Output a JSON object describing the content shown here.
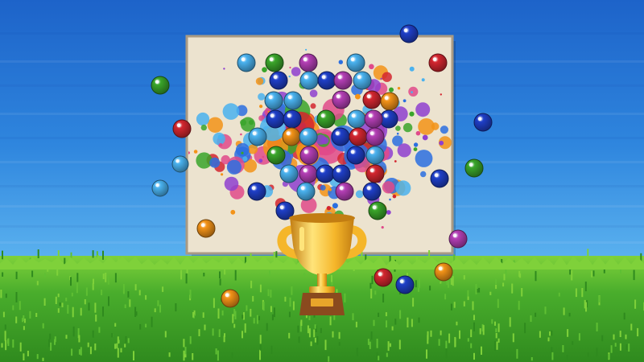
{
  "scene": {
    "description_free": true,
    "palette": {
      "sky_top": "#1d63c9",
      "sky_mid": "#2f86de",
      "sky_low": "#5db4f0",
      "grass_top": "#7fd13a",
      "grass": "#49ad2c",
      "grass_dark": "#2f8a1e",
      "canvas": "#ece3cf",
      "canvas_border": "#a99a83",
      "trophy_gold": "#f5b62a",
      "trophy_shadow": "#c27d12",
      "trophy_highlight": "#ffe47a",
      "trophy_base": "#8a4a1e",
      "plaque": "#e8a52a"
    },
    "ball_colors": {
      "blue": "#1f3fc8",
      "lightblue": "#4ab2ef",
      "green": "#3aa52a",
      "red": "#d3262f",
      "orange": "#f39318",
      "magenta": "#b43fb5"
    },
    "splat_colors": [
      "#2b6fe0",
      "#f39318",
      "#3aa52a",
      "#d3262f",
      "#8f3fcf",
      "#4ab2ef",
      "#e04a8a"
    ],
    "balls_on_canvas": [
      {
        "color": "lightblue"
      },
      {
        "color": "green"
      },
      {
        "color": "magenta"
      },
      {
        "color": "lightblue"
      },
      {
        "color": "blue"
      },
      {
        "color": "lightblue"
      },
      {
        "color": "blue"
      },
      {
        "color": "magenta"
      },
      {
        "color": "lightblue"
      },
      {
        "color": "lightblue"
      },
      {
        "color": "lightblue"
      },
      {
        "color": "magenta"
      },
      {
        "color": "red"
      },
      {
        "color": "orange"
      },
      {
        "color": "blue"
      },
      {
        "color": "blue"
      },
      {
        "color": "green"
      },
      {
        "color": "lightblue"
      },
      {
        "color": "blue"
      },
      {
        "color": "magenta"
      },
      {
        "color": "lightblue"
      },
      {
        "color": "orange"
      },
      {
        "color": "lightblue"
      },
      {
        "color": "blue"
      },
      {
        "color": "red"
      },
      {
        "color": "magenta"
      },
      {
        "color": "green"
      },
      {
        "color": "magenta"
      },
      {
        "color": "blue"
      },
      {
        "color": "lightblue"
      },
      {
        "color": "lightblue"
      },
      {
        "color": "magenta"
      },
      {
        "color": "blue"
      },
      {
        "color": "blue"
      },
      {
        "color": "red"
      },
      {
        "color": "blue"
      },
      {
        "color": "lightblue"
      },
      {
        "color": "magenta"
      },
      {
        "color": "blue"
      },
      {
        "color": "blue"
      },
      {
        "color": "green"
      }
    ],
    "balls_flying": [
      {
        "color": "blue"
      },
      {
        "color": "red"
      },
      {
        "color": "green"
      },
      {
        "color": "red"
      },
      {
        "color": "lightblue"
      },
      {
        "color": "lightblue"
      },
      {
        "color": "blue"
      },
      {
        "color": "green"
      },
      {
        "color": "blue"
      },
      {
        "color": "orange"
      },
      {
        "color": "magenta"
      },
      {
        "color": "orange"
      },
      {
        "color": "red"
      },
      {
        "color": "blue"
      },
      {
        "color": "orange"
      }
    ]
  }
}
